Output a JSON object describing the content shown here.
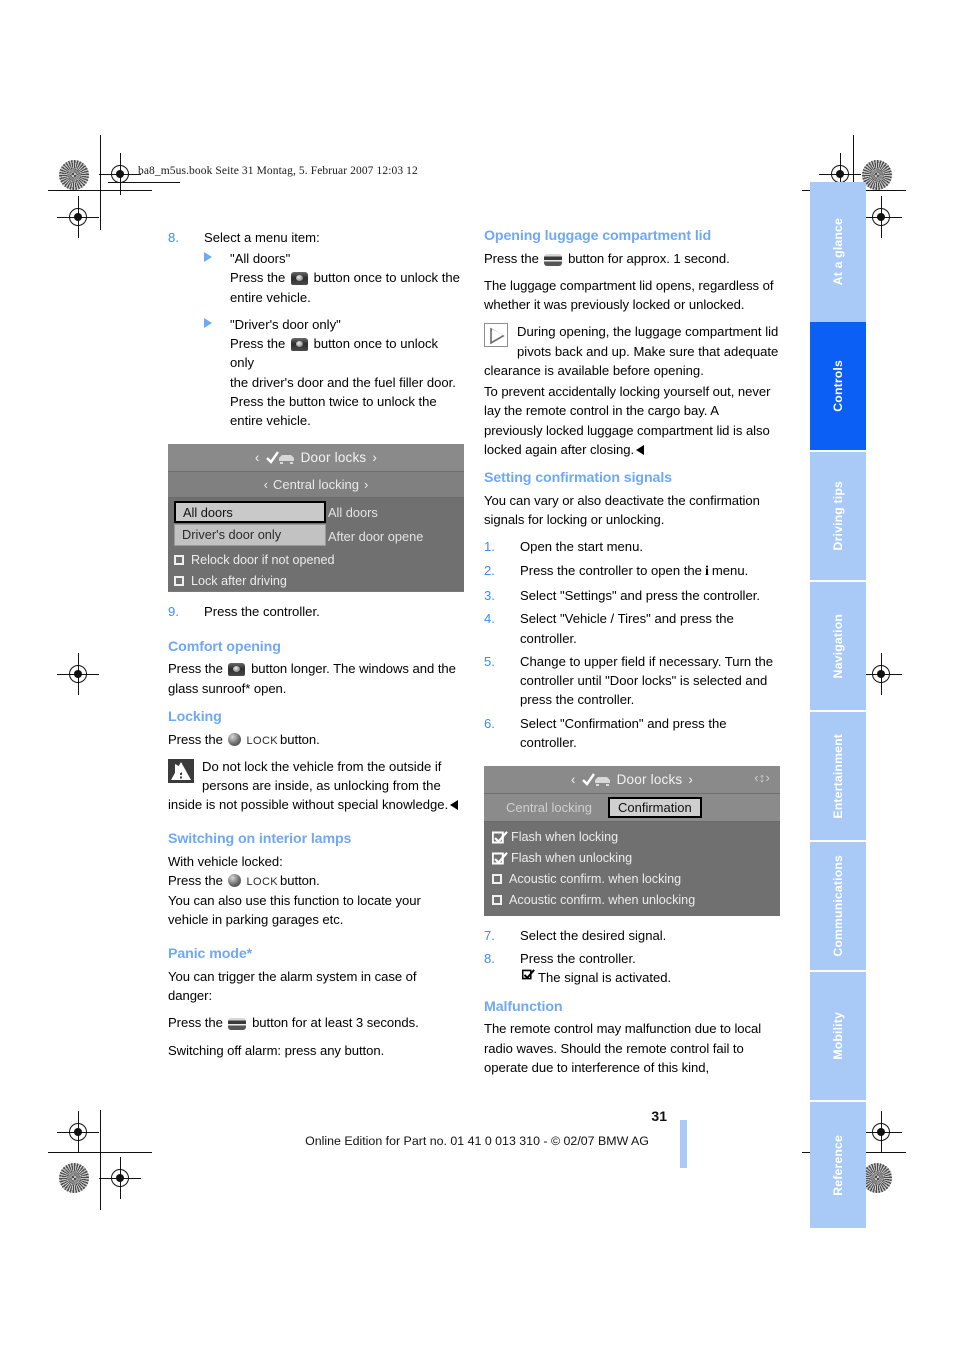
{
  "header": {
    "file_line": "ba8_m5us.book  Seite 31  Montag, 5. Februar 2007  12:03 12"
  },
  "footer": {
    "page_number": "31",
    "edition_line": "Online Edition for Part no. 01 41 0 013 310 - © 02/07 BMW AG"
  },
  "tabs": [
    {
      "label": "At a glance",
      "active": false
    },
    {
      "label": "Controls",
      "active": true
    },
    {
      "label": "Driving tips",
      "active": false
    },
    {
      "label": "Navigation",
      "active": false
    },
    {
      "label": "Entertainment",
      "active": false
    },
    {
      "label": "Communications",
      "active": false
    },
    {
      "label": "Mobility",
      "active": false
    },
    {
      "label": "Reference",
      "active": false
    }
  ],
  "colors": {
    "heading_blue": "#6fa8f5",
    "tab_inactive": "#a9caf7",
    "tab_active": "#0b5ff5",
    "number_blue": "#3d8bf2"
  },
  "left_column": {
    "step8": {
      "num": "8.",
      "text": "Select a menu item:",
      "items": [
        {
          "title": "\"All doors\"",
          "line1_pre": "Press the",
          "line1_post": "button once to unlock the",
          "line2": "entire vehicle."
        },
        {
          "title": "\"Driver's door only\"",
          "line1_pre": "Press the",
          "line1_post": "button once to unlock only",
          "line2": "the driver's door and the fuel filler door.",
          "line3": "Press the button twice to unlock the",
          "line4": "entire vehicle."
        }
      ]
    },
    "figure1": {
      "title": "Door locks",
      "subtitle": "Central locking",
      "dropdown_options": [
        "All doors",
        "Driver's door only"
      ],
      "right_options": [
        "All doors",
        "After door opene"
      ],
      "checkbox_rows": [
        {
          "label": "Relock door if not opened",
          "checked": false
        },
        {
          "label": "Lock after driving",
          "checked": false
        }
      ]
    },
    "step9": {
      "num": "9.",
      "text": "Press the controller."
    },
    "comfort_opening": {
      "heading": "Comfort opening",
      "line1_pre": "Press the",
      "line1_post": "button longer. The windows and",
      "line2": "the glass sunroof* open."
    },
    "locking": {
      "heading": "Locking",
      "press_pre": "Press the",
      "lock_word": "LOCK",
      "press_post": "button.",
      "warning": "Do not lock the vehicle from the outside if persons are inside, as unlocking from the inside is not possible without special knowledge."
    },
    "interior_lamps": {
      "heading": "Switching on interior lamps",
      "line1": "With vehicle locked:",
      "press_pre": "Press the",
      "lock_word": "LOCK",
      "press_post": "button.",
      "line3": "You can also use this function to locate your",
      "line4": "vehicle in parking garages etc."
    },
    "panic_mode": {
      "heading": "Panic mode*",
      "line1": "You can trigger the alarm system in case of danger:",
      "press_pre": "Press the",
      "press_post": "button for at least 3 seconds.",
      "line3": "Switching off alarm: press any button."
    }
  },
  "right_column": {
    "luggage": {
      "heading": "Opening luggage compartment lid",
      "press_pre": "Press the",
      "press_post": "button for approx. 1 second.",
      "para1": "The luggage compartment lid opens, regardless of whether it was previously locked or unlocked.",
      "note": "During opening, the luggage compartment lid pivots back and up. Make sure that adequate clearance is available before opening.",
      "para2": "To prevent accidentally locking yourself out, never lay the remote control in the cargo bay. A previously locked luggage compartment lid is also locked again after closing."
    },
    "confirmation": {
      "heading": "Setting confirmation signals",
      "intro": "You can vary or also deactivate the confirmation signals for locking or unlocking.",
      "steps": [
        {
          "num": "1.",
          "text": "Open the start menu."
        },
        {
          "num": "2.",
          "text_pre": "Press the controller to open the",
          "text_post": "menu."
        },
        {
          "num": "3.",
          "text": "Select \"Settings\" and press the controller."
        },
        {
          "num": "4.",
          "text": "Select \"Vehicle / Tires\" and press the controller."
        },
        {
          "num": "5.",
          "text": "Change to upper field if necessary. Turn the controller until \"Door locks\" is selected and press the controller."
        },
        {
          "num": "6.",
          "text": "Select \"Confirmation\" and press the controller."
        }
      ],
      "steps_after": [
        {
          "num": "7.",
          "text": "Select the desired signal."
        },
        {
          "num": "8.",
          "text": "Press the controller."
        }
      ],
      "activated_text": "The signal is activated."
    },
    "figure2": {
      "title": "Door locks",
      "tab_inactive": "Central locking",
      "tab_active": "Confirmation",
      "rows": [
        {
          "label": "Flash when locking",
          "checked": true
        },
        {
          "label": "Flash when unlocking",
          "checked": true
        },
        {
          "label": "Acoustic confirm. when locking",
          "checked": false
        },
        {
          "label": "Acoustic confirm. when unlocking",
          "checked": false
        }
      ]
    },
    "malfunction": {
      "heading": "Malfunction",
      "text": "The remote control may malfunction due to local radio waves. Should the remote control fail to operate due to interference of this kind,"
    }
  }
}
